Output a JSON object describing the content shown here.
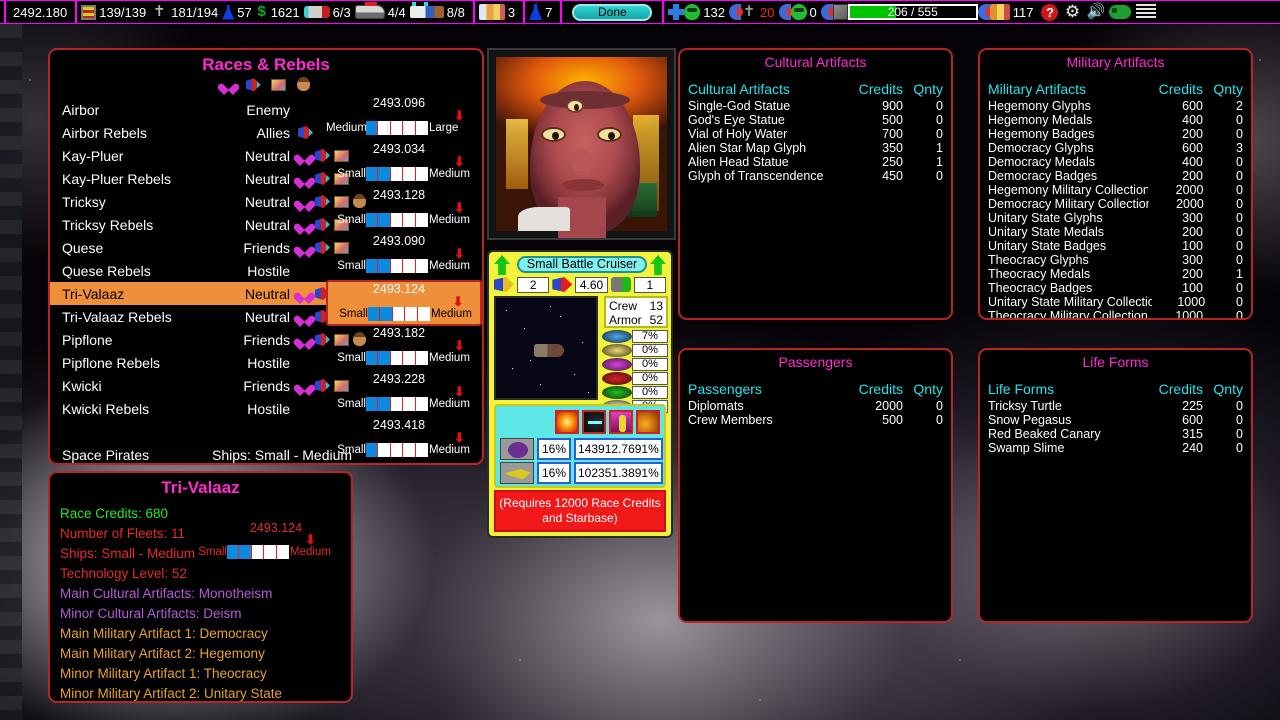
{
  "topbar": {
    "stardate": "2492.180",
    "cargo": "139/139",
    "repair": "181/194",
    "fuel": "57",
    "money": "1621",
    "ships_a": "6/3",
    "ships_b": "4/4",
    "ships_c": "8/8",
    "people": "3",
    "flask": "7",
    "done_label": "Done",
    "troops": "132",
    "troops_loss": "20",
    "cargo_units": "0",
    "health": "206 / 555",
    "health_pct": 37,
    "population": "117",
    "help_glyph": "?",
    "gear_glyph": "⚙",
    "speaker_glyph": "🔊",
    "accent_magenta": "#ff00ff",
    "health_green": "#00c400"
  },
  "races_panel": {
    "title": "Races & Rebels",
    "rows": [
      {
        "name": "Airbor",
        "relation": "Enemy",
        "icons": []
      },
      {
        "name": "Airbor Rebels",
        "relation": "Allies",
        "icons": [
          "ship"
        ]
      },
      {
        "name": "Kay-Pluer",
        "relation": "Neutral",
        "icons": [
          "heart",
          "ship",
          "card"
        ]
      },
      {
        "name": "Kay-Pluer Rebels",
        "relation": "Neutral",
        "icons": [
          "heart",
          "ship",
          "card"
        ]
      },
      {
        "name": "Tricksy",
        "relation": "Neutral",
        "icons": [
          "heart",
          "ship",
          "card",
          "head"
        ]
      },
      {
        "name": "Tricksy Rebels",
        "relation": "Neutral",
        "icons": [
          "heart",
          "ship",
          "card"
        ]
      },
      {
        "name": "Quese",
        "relation": "Friends",
        "icons": [
          "heart",
          "ship",
          "card"
        ]
      },
      {
        "name": "Quese Rebels",
        "relation": "Hostile",
        "icons": []
      },
      {
        "name": "Tri-Valaaz",
        "relation": "Neutral",
        "icons": [
          "heart",
          "ship"
        ],
        "selected": true
      },
      {
        "name": "Tri-Valaaz Rebels",
        "relation": "Neutral",
        "icons": [
          "heart",
          "ship"
        ]
      },
      {
        "name": "Pipflone",
        "relation": "Friends",
        "icons": [
          "heart",
          "ship",
          "card",
          "head"
        ]
      },
      {
        "name": "Pipflone Rebels",
        "relation": "Hostile",
        "icons": []
      },
      {
        "name": "Kwicki",
        "relation": "Friends",
        "icons": [
          "heart",
          "ship",
          "card"
        ]
      },
      {
        "name": "Kwicki Rebels",
        "relation": "Hostile",
        "icons": []
      },
      {
        "name": "",
        "relation": "",
        "icons": []
      },
      {
        "name": "Space Pirates",
        "relation": "Ships: Small - Medium",
        "icons": [],
        "wide": true
      }
    ],
    "fleet_groups": [
      {
        "date": "2493.096",
        "left": "Medium",
        "right": "Large",
        "fill": 1,
        "arrow": 82
      },
      {
        "date": "2493.034",
        "left": "Small",
        "right": "Medium",
        "fill": 2,
        "arrow": 82
      },
      {
        "date": "2493.128",
        "left": "Small",
        "right": "Medium",
        "fill": 2,
        "arrow": 82
      },
      {
        "date": "2493.090",
        "left": "Small",
        "right": "Medium",
        "fill": 2,
        "arrow": 82
      },
      {
        "date": "2493.124",
        "left": "Small",
        "right": "Medium",
        "fill": 2,
        "arrow": 82,
        "selected": true
      },
      {
        "date": "2493.182",
        "left": "Small",
        "right": "Medium",
        "fill": 2,
        "arrow": 82
      },
      {
        "date": "2493.228",
        "left": "Small",
        "right": "Medium",
        "fill": 2,
        "arrow": 82
      },
      {
        "date": "2493.418",
        "left": "Small",
        "right": "Medium",
        "fill": 1,
        "arrow": 82
      }
    ]
  },
  "detail_panel": {
    "title": "Tri-Valaaz",
    "lines": [
      {
        "text": "Race Credits: 680",
        "color": "green"
      },
      {
        "text": "Number of Fleets: 11",
        "color": "red"
      },
      {
        "text": "Ships: Small - Medium",
        "color": "red"
      },
      {
        "text": "Technology Level: 52",
        "color": "red"
      },
      {
        "text": "Main Cultural Artifacts: Monotheism",
        "color": "purple"
      },
      {
        "text": "Minor Cultural Artifacts: Deism",
        "color": "purple"
      },
      {
        "text": "Main Military Artifact 1: Democracy",
        "color": "orange"
      },
      {
        "text": "Main Military Artifact 2: Hegemony",
        "color": "orange"
      },
      {
        "text": "Minor Military Artifact 1: Theocracy",
        "color": "orange"
      },
      {
        "text": "Minor Military Artifact 2: Unitary State",
        "color": "orange"
      }
    ],
    "bar": {
      "date": "2493.124",
      "left": "Small",
      "right": "Medium"
    }
  },
  "ship_panel": {
    "name": "Small Battle Cruiser",
    "stat_a": "2",
    "stat_b": "4.60",
    "stat_c": "1",
    "crew_label": "Crew",
    "crew_value": "13",
    "armor_label": "Armor",
    "armor_value": "52",
    "shields": [
      {
        "color": "#4aa8f0",
        "value": "7%"
      },
      {
        "color": "#f0dc70",
        "value": "0%"
      },
      {
        "color": "#e040e0",
        "value": "0%"
      },
      {
        "color": "#e02020",
        "value": "0%"
      },
      {
        "color": "#20c020",
        "value": "0%"
      },
      {
        "color": "#f0e8d0",
        "value": "0%"
      }
    ],
    "weapons": [
      {
        "tile": "blob",
        "pct": "16%",
        "n1": "14",
        "n2": "391",
        "n3": "2.76",
        "n4": "91%"
      },
      {
        "tile": "fly",
        "pct": "16%",
        "n1": "10",
        "n2": "235",
        "n3": "1.38",
        "n4": "91%"
      }
    ],
    "requirement": "(Requires 12000 Race Credits and Starbase)"
  },
  "cultural_artifacts": {
    "title": "Cultural Artifacts",
    "col_name": "Cultural Artifacts",
    "col_credits": "Credits",
    "col_qty": "Qnty",
    "rows": [
      {
        "name": "Single-God Statue",
        "credits": "900",
        "qty": "0"
      },
      {
        "name": "God's Eye Statue",
        "credits": "500",
        "qty": "0"
      },
      {
        "name": "Vial of Holy Water",
        "credits": "700",
        "qty": "0"
      },
      {
        "name": "Alien Star Map Glyph",
        "credits": "350",
        "qty": "1"
      },
      {
        "name": "Alien Head Statue",
        "credits": "250",
        "qty": "1"
      },
      {
        "name": "Glyph of Transcendence",
        "credits": "450",
        "qty": "0"
      }
    ]
  },
  "military_artifacts": {
    "title": "Military Artifacts",
    "col_name": "Military Artifacts",
    "col_credits": "Credits",
    "col_qty": "Qnty",
    "rows": [
      {
        "name": "Hegemony Glyphs",
        "credits": "600",
        "qty": "2"
      },
      {
        "name": "Hegemony Medals",
        "credits": "400",
        "qty": "0"
      },
      {
        "name": "Hegemony Badges",
        "credits": "200",
        "qty": "0"
      },
      {
        "name": "Democracy Glyphs",
        "credits": "600",
        "qty": "3"
      },
      {
        "name": "Democracy Medals",
        "credits": "400",
        "qty": "0"
      },
      {
        "name": "Democracy Badges",
        "credits": "200",
        "qty": "0"
      },
      {
        "name": "Hegemony Military Collection",
        "credits": "2000",
        "qty": "0"
      },
      {
        "name": "Democracy Military Collection",
        "credits": "2000",
        "qty": "0"
      },
      {
        "name": "Unitary State Glyphs",
        "credits": "300",
        "qty": "0"
      },
      {
        "name": "Unitary State Medals",
        "credits": "200",
        "qty": "0"
      },
      {
        "name": "Unitary State Badges",
        "credits": "100",
        "qty": "0"
      },
      {
        "name": "Theocracy Glyphs",
        "credits": "300",
        "qty": "0"
      },
      {
        "name": "Theocracy Medals",
        "credits": "200",
        "qty": "1"
      },
      {
        "name": "Theocracy Badges",
        "credits": "100",
        "qty": "0"
      },
      {
        "name": "Unitary State Military Collection",
        "credits": "1000",
        "qty": "0"
      },
      {
        "name": "Theocracy Military Collection",
        "credits": "1000",
        "qty": "0"
      }
    ]
  },
  "passengers": {
    "title": "Passengers",
    "col_name": "Passengers",
    "col_credits": "Credits",
    "col_qty": "Qnty",
    "rows": [
      {
        "name": "Diplomats",
        "credits": "2000",
        "qty": "0"
      },
      {
        "name": "Crew Members",
        "credits": "500",
        "qty": "0"
      }
    ]
  },
  "life_forms": {
    "title": "Life Forms",
    "col_name": "Life Forms",
    "col_credits": "Credits",
    "col_qty": "Qnty",
    "rows": [
      {
        "name": "Tricksy Turtle",
        "credits": "225",
        "qty": "0"
      },
      {
        "name": "Snow Pegasus",
        "credits": "600",
        "qty": "0"
      },
      {
        "name": "Red Beaked Canary",
        "credits": "315",
        "qty": "0"
      },
      {
        "name": "Swamp Slime",
        "credits": "240",
        "qty": "0"
      }
    ]
  }
}
